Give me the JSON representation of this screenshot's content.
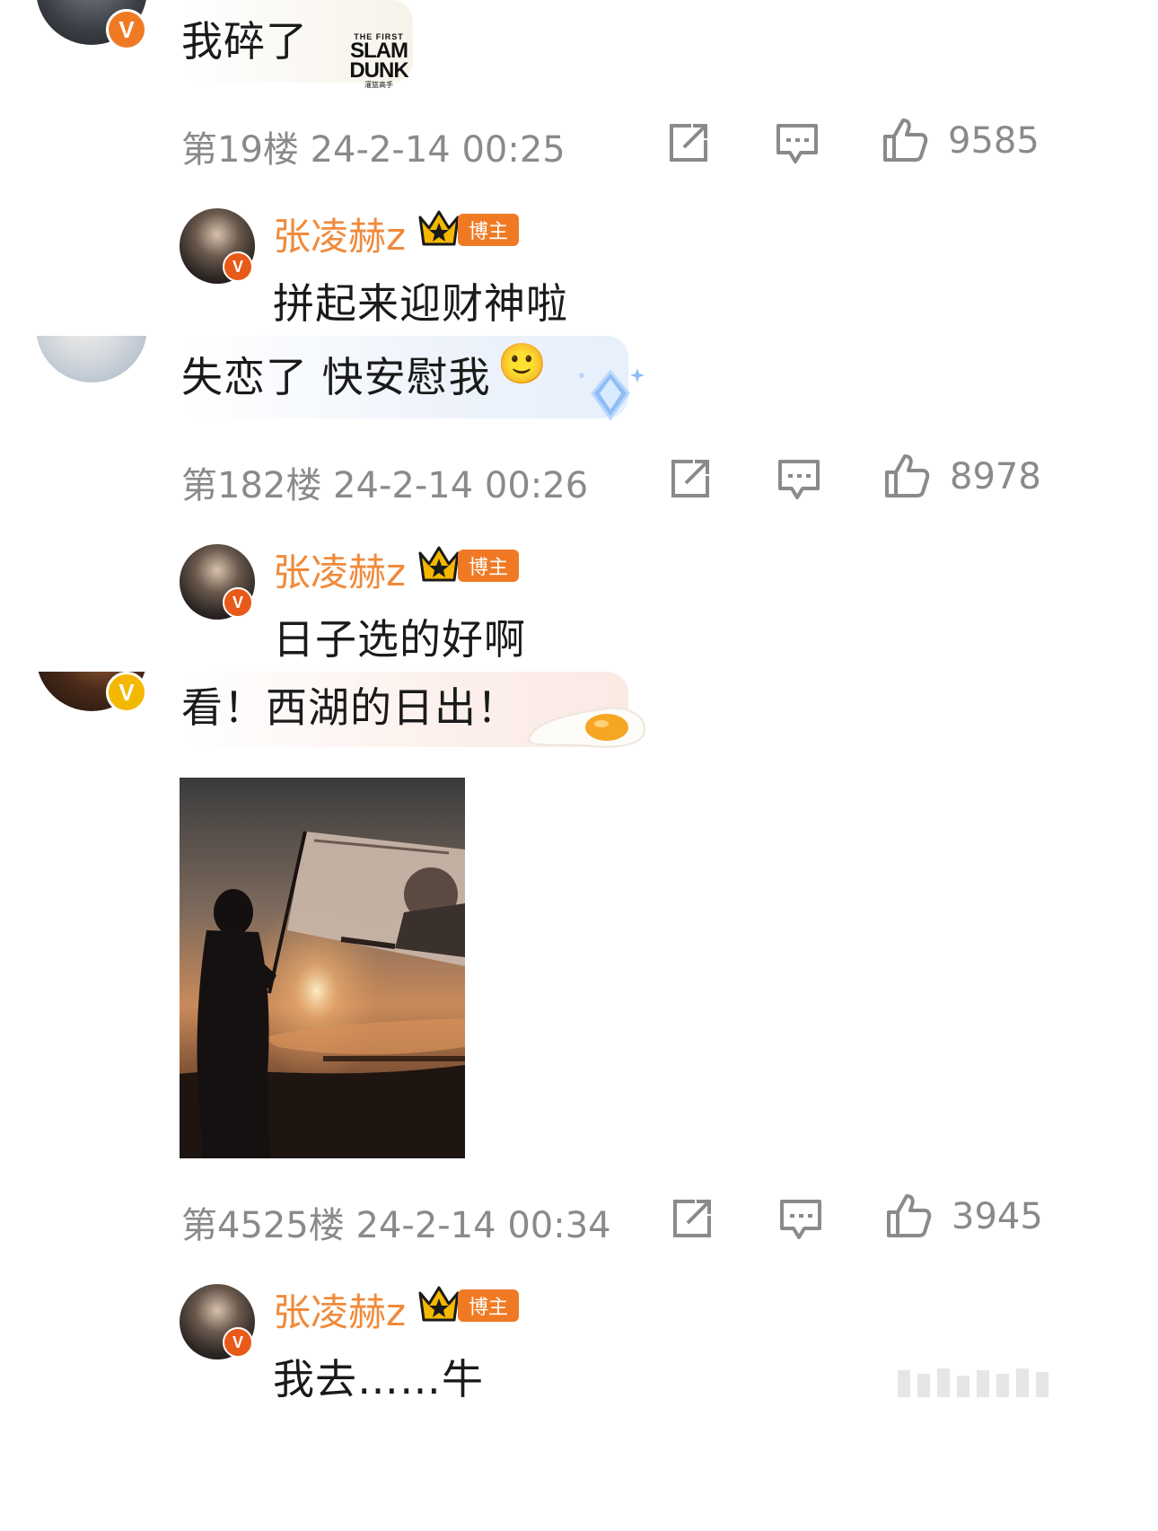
{
  "comments": [
    {
      "text": "我碎了",
      "sticker": {
        "top": "THE FIRST",
        "main1": "SLAM",
        "main2": "DUNK",
        "sub": "灌篮高手"
      },
      "meta": "第19楼 24-2-14 00:25",
      "likes": "9585",
      "reply": {
        "name": "张凌赫z",
        "badge": "博主",
        "text": "拼起来迎财神啦"
      }
    },
    {
      "text": "失恋了 快安慰我",
      "emoji": "🙂",
      "meta": "第182楼 24-2-14 00:26",
      "likes": "8978",
      "reply": {
        "name": "张凌赫z",
        "badge": "博主",
        "text": "日子选的好啊"
      }
    },
    {
      "text": "看！西湖的日出！",
      "meta": "第4525楼 24-2-14 00:34",
      "likes": "3945",
      "reply": {
        "name": "张凌赫z",
        "badge": "博主",
        "text": "我去……牛"
      }
    }
  ],
  "colors": {
    "accent": "#f08a3a",
    "meta": "#8a8a8a",
    "verified_orange": "#f07a24",
    "verified_yellow": "#f5b800"
  },
  "icons": [
    "repost-icon",
    "comment-icon",
    "like-icon",
    "verified-icon",
    "crown-icon"
  ]
}
